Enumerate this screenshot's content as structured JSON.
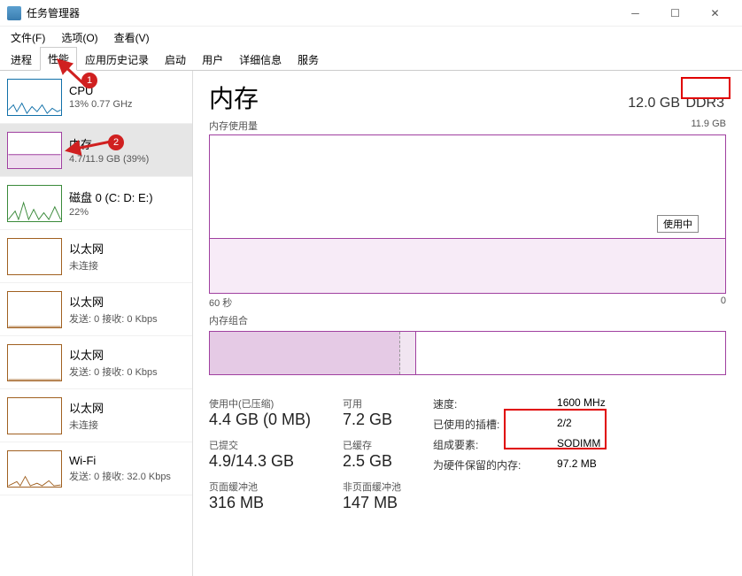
{
  "window": {
    "title": "任务管理器"
  },
  "menu": {
    "file": "文件(F)",
    "options": "选项(O)",
    "view": "查看(V)"
  },
  "tabs": {
    "processes": "进程",
    "performance": "性能",
    "app_history": "应用历史记录",
    "startup": "启动",
    "users": "用户",
    "details": "详细信息",
    "services": "服务"
  },
  "sidebar": {
    "cpu": {
      "name": "CPU",
      "sub": "13% 0.77 GHz"
    },
    "memory": {
      "name": "内存",
      "sub": "4.7/11.9 GB (39%)"
    },
    "disk": {
      "name": "磁盘 0 (C: D: E:)",
      "sub": "22%"
    },
    "eth0": {
      "name": "以太网",
      "sub": "未连接"
    },
    "eth1": {
      "name": "以太网",
      "sub": "发送: 0 接收: 0 Kbps"
    },
    "eth2": {
      "name": "以太网",
      "sub": "发送: 0 接收: 0 Kbps"
    },
    "eth3": {
      "name": "以太网",
      "sub": "未连接"
    },
    "wifi": {
      "name": "Wi-Fi",
      "sub": "发送: 0 接收: 32.0 Kbps"
    }
  },
  "panel": {
    "title": "内存",
    "total": "12.0 GB",
    "type": "DDR3",
    "usage_label": "内存使用量",
    "usage_max": "11.9 GB",
    "in_use_tag": "使用中",
    "time_left": "60 秒",
    "time_right": "0",
    "comp_label": "内存组合"
  },
  "stats": {
    "in_use_label": "使用中(已压缩)",
    "in_use_val": "4.4 GB (0 MB)",
    "avail_label": "可用",
    "avail_val": "7.2 GB",
    "commit_label": "已提交",
    "commit_val": "4.9/14.3 GB",
    "cached_label": "已缓存",
    "cached_val": "2.5 GB",
    "paged_label": "页面缓冲池",
    "paged_val": "316 MB",
    "nonpaged_label": "非页面缓冲池",
    "nonpaged_val": "147 MB"
  },
  "kv": {
    "speed_k": "速度:",
    "speed_v": "1600 MHz",
    "slots_k": "已使用的插槽:",
    "slots_v": "2/2",
    "form_k": "组成要素:",
    "form_v": "SODIMM",
    "hw_k": "为硬件保留的内存:",
    "hw_v": "97.2 MB"
  },
  "annotations": {
    "badge1": "1",
    "badge2": "2"
  },
  "chart_data": {
    "type": "area",
    "title": "内存使用量",
    "xlabel": "60 秒",
    "ylabel": "",
    "ylim": [
      0,
      11.9
    ],
    "series": [
      {
        "name": "使用中",
        "values": [
          4.7,
          4.7,
          4.7,
          4.7,
          4.7,
          4.7,
          4.7,
          4.7,
          4.7,
          4.7,
          4.7,
          4.6,
          4.6,
          4.5
        ]
      }
    ]
  }
}
